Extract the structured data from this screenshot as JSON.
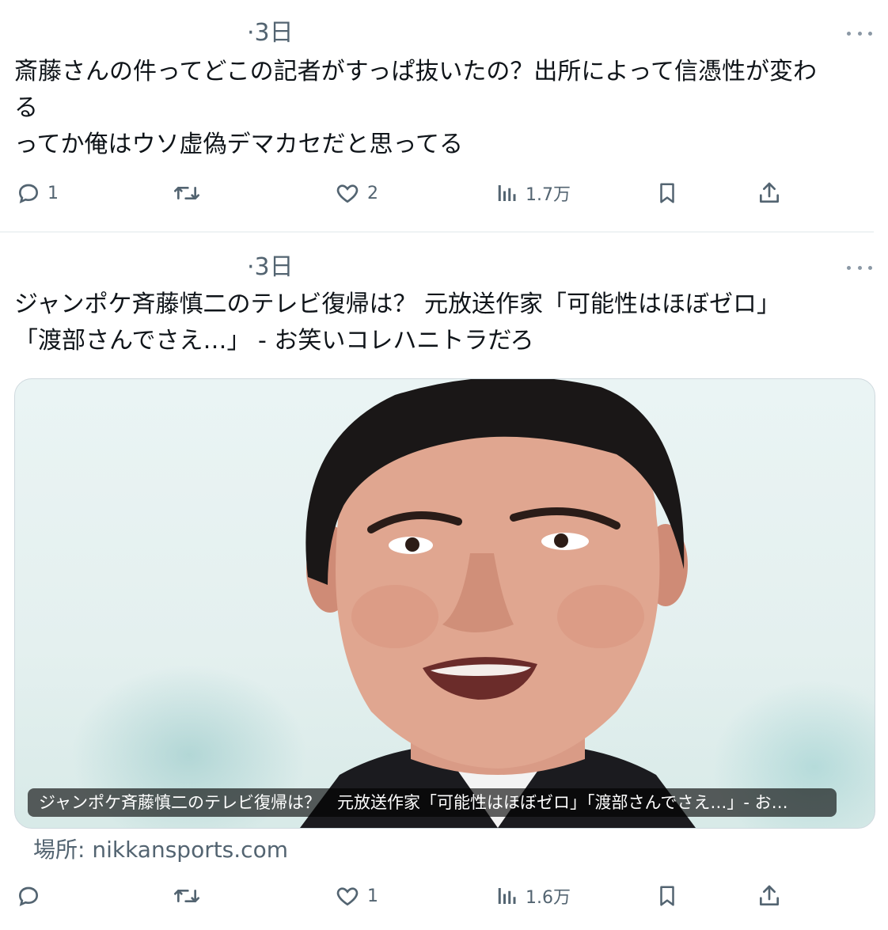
{
  "tweets": [
    {
      "time": "·3日",
      "text": "斎藤さんの件ってどこの記者がすっぱ抜いたの？出所によって信憑性が変わ\nる\nってか俺はウソ虚偽デマカセだと思ってる",
      "actions": {
        "replies": "1",
        "retweets": "",
        "likes": "2",
        "views": "1.7万"
      }
    },
    {
      "time": "·3日",
      "text": "ジャンポケ斉藤慎二のテレビ復帰は？ 元放送作家「可能性はほぼゼロ」\n「渡部さんでさえ…」 - お笑いコレハニトラだろ",
      "card": {
        "caption": "ジャンポケ斉藤慎二のテレビ復帰は？　元放送作家「可能性はほぼゼロ」「渡部さんでさえ…」- お…",
        "source": "場所: nikkansports.com"
      },
      "actions": {
        "replies": "",
        "retweets": "",
        "likes": "1",
        "views": "1.6万"
      }
    }
  ],
  "icons": {
    "more": "more-horizontal-icon",
    "reply": "reply-bubble-icon",
    "retweet": "retweet-icon",
    "like": "heart-icon",
    "views": "views-bar-chart-icon",
    "bookmark": "bookmark-icon",
    "share": "share-upload-icon"
  },
  "colors": {
    "text": "#0f1419",
    "secondary": "#536471",
    "divider": "#eff3f4",
    "card_border": "#cfd9de"
  }
}
